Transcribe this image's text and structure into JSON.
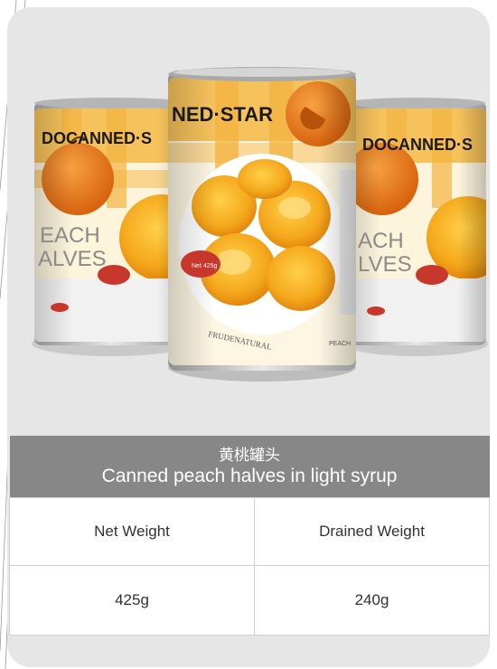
{
  "product": {
    "title_zh": "黄桃罐头",
    "title_en": "Canned peach halves in light syrup"
  },
  "table": {
    "headers": [
      "Net Weight",
      "Drained Weight"
    ],
    "values": [
      "425g",
      "240g"
    ]
  },
  "cans": {
    "brand_partial_left": "DOCANNED·S",
    "brand_partial_center": "NED·STAR",
    "brand_partial_right": "DOCANNED·S",
    "label_left": [
      "EACH",
      "ALVES"
    ],
    "label_right": [
      "ACH",
      "LVES"
    ],
    "rim_text": "FRUDENATURAL",
    "side_text": "PEACH",
    "badge_text": "Net 425g"
  },
  "colors": {
    "card_bg": "#e6e6e6",
    "title_bar": "#878787",
    "peach": "#f3a21e",
    "peach_dark": "#d9790a",
    "stripe": "#f6c25c"
  }
}
